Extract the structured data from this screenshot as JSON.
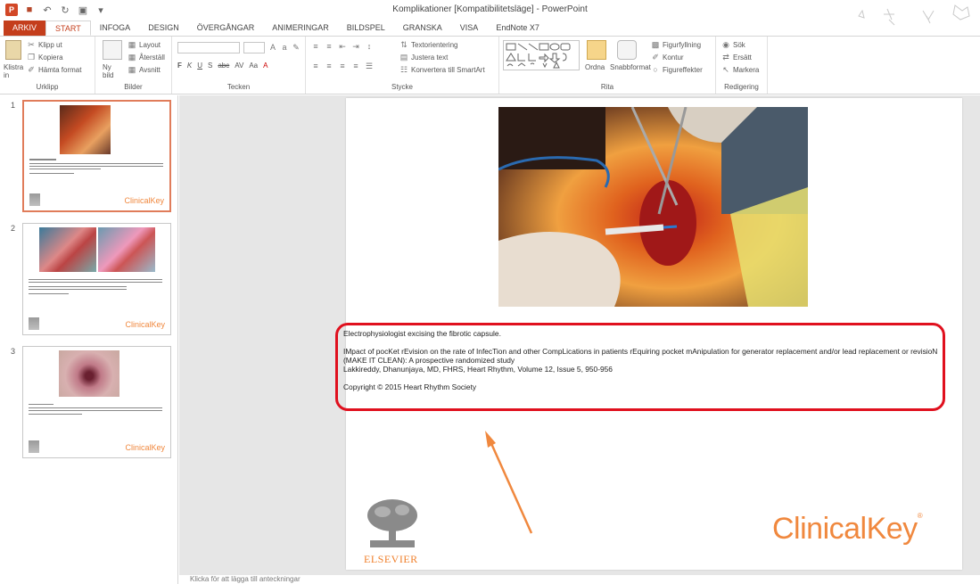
{
  "window": {
    "title": "Komplikationer [Kompatibilitetsläge] - PowerPoint"
  },
  "tabs": [
    {
      "label": "ARKIV"
    },
    {
      "label": "START"
    },
    {
      "label": "INFOGA"
    },
    {
      "label": "DESIGN"
    },
    {
      "label": "ÖVERGÅNGAR"
    },
    {
      "label": "ANIMERINGAR"
    },
    {
      "label": "BILDSPEL"
    },
    {
      "label": "GRANSKA"
    },
    {
      "label": "VISA"
    },
    {
      "label": "EndNote X7"
    }
  ],
  "ribbon": {
    "clipboard": {
      "paste": "Klistra in",
      "cut": "Klipp ut",
      "copy": "Kopiera",
      "format_painter": "Hämta format",
      "label": "Urklipp"
    },
    "slides": {
      "new_slide": "Ny bild",
      "layout": "Layout",
      "reset": "Återställ",
      "section": "Avsnitt",
      "label": "Bilder"
    },
    "font": {
      "label": "Tecken",
      "bold": "F",
      "italic": "K",
      "underline": "U",
      "shadow": "S",
      "strike": "abc",
      "case": "Aa"
    },
    "paragraph": {
      "text_direction": "Textorientering",
      "align_text": "Justera text",
      "smartart": "Konvertera till SmartArt",
      "label": "Stycke"
    },
    "drawing": {
      "arrange": "Ordna",
      "quick_styles": "Snabbformat",
      "fill": "Figurfyllning",
      "outline": "Kontur",
      "effects": "Figureffekter",
      "label": "Rita"
    },
    "editing": {
      "find": "Sök",
      "replace": "Ersätt",
      "select": "Markera",
      "label": "Redigering"
    }
  },
  "thumbnails": [
    {
      "number": "1",
      "logo": "ClinicalKey"
    },
    {
      "number": "2",
      "logo": "ClinicalKey"
    },
    {
      "number": "3",
      "logo": "ClinicalKey"
    }
  ],
  "slide": {
    "caption_line1": "Electrophysiologist excising the fibrotic capsule.",
    "caption_line2": "IMpact of pocKet rEvision on the rate of InfecTion and other CompLications in patients rEquiring pocket mAnipulation for generator replacement and/or lead replacement or revisioN (MAKE IT CLEAN): A prospective randomized study",
    "caption_line3": "Lakkireddy, Dhanunjaya, MD, FHRS, Heart Rhythm, Volume 12, Issue 5, 950-956",
    "caption_line4": "Copyright © 2015 Heart Rhythm Society",
    "publisher": "ELSEVIER",
    "brand": "ClinicalKey"
  },
  "status": {
    "notes_hint": "Klicka för att lägga till anteckningar"
  },
  "colors": {
    "accent": "#c43e1c",
    "highlight_box": "#e0101e",
    "arrow": "#f0883e",
    "brand": "#f0883e"
  }
}
